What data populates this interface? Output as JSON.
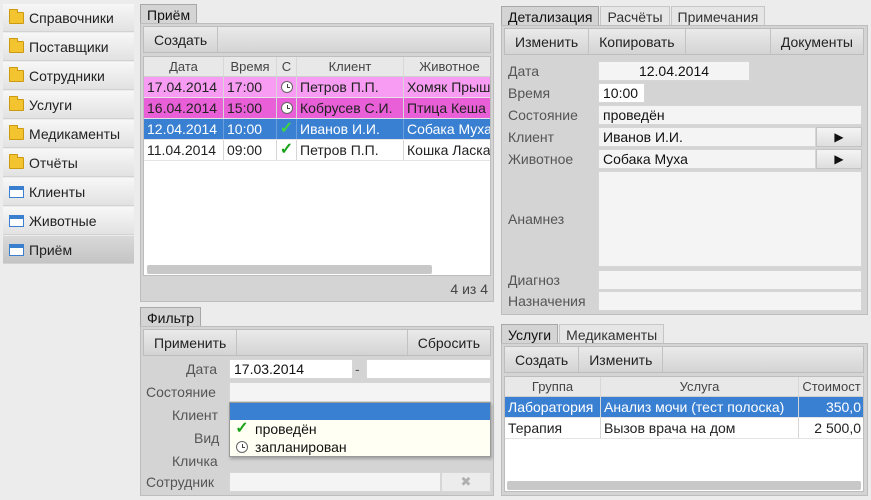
{
  "sidebar": {
    "items": [
      {
        "label": "Справочники",
        "icon": "folder-icon"
      },
      {
        "label": "Поставщики",
        "icon": "folder-icon"
      },
      {
        "label": "Сотрудники",
        "icon": "folder-icon"
      },
      {
        "label": "Услуги",
        "icon": "folder-icon"
      },
      {
        "label": "Медикаменты",
        "icon": "folder-icon"
      },
      {
        "label": "Отчёты",
        "icon": "folder-icon"
      },
      {
        "label": "Клиенты",
        "icon": "window-icon"
      },
      {
        "label": "Животные",
        "icon": "window-icon"
      },
      {
        "label": "Приём",
        "icon": "window-icon",
        "active": true
      }
    ]
  },
  "reception": {
    "tab": "Приём",
    "create_label": "Создать",
    "columns": [
      "Дата",
      "Время",
      "С",
      "Клиент",
      "Животное"
    ],
    "rows": [
      {
        "date": "17.04.2014",
        "time": "17:00",
        "status_icon": "clock-icon",
        "client": "Петров П.П.",
        "animal": "Хомяк Прыш",
        "bg": "#f79cf2"
      },
      {
        "date": "16.04.2014",
        "time": "15:00",
        "status_icon": "clock-icon",
        "client": "Кобрусев С.И.",
        "animal": "Птица Кеша",
        "bg": "#e85fd8"
      },
      {
        "date": "12.04.2014",
        "time": "10:00",
        "status_icon": "check-icon",
        "client": "Иванов И.И.",
        "animal": "Собака Муха",
        "bg": "#3a80d2",
        "selected": true
      },
      {
        "date": "11.04.2014",
        "time": "09:00",
        "status_icon": "check-icon",
        "client": "Петров П.П.",
        "animal": "Кошка Ласка",
        "bg": "#ffffff"
      }
    ],
    "count": "4 из 4"
  },
  "filter": {
    "tab": "Фильтр",
    "apply_label": "Применить",
    "reset_label": "Сбросить",
    "date_label": "Дата",
    "date_from": "17.03.2014",
    "date_sep": "-",
    "date_to": "",
    "state_label": "Состояние",
    "client_label": "Клиент",
    "type_label": "Вид",
    "nickname_label": "Кличка",
    "staff_label": "Сотрудник",
    "clear_glyph": "✖",
    "state_options": [
      {
        "label": "проведён",
        "icon": "check-icon"
      },
      {
        "label": "запланирован",
        "icon": "clock-icon"
      }
    ]
  },
  "details": {
    "tabs": [
      "Детализация",
      "Расчёты",
      "Примечания"
    ],
    "buttons": {
      "edit": "Изменить",
      "copy": "Копировать",
      "docs": "Документы"
    },
    "fields": {
      "date_label": "Дата",
      "date": "12.04.2014",
      "time_label": "Время",
      "time": "10:00",
      "state_label": "Состояние",
      "state": "проведён",
      "client_label": "Клиент",
      "client": "Иванов И.И.",
      "animal_label": "Животное",
      "animal": "Собака Муха",
      "anamnesis_label": "Анамнез",
      "anamnesis": "",
      "diagnosis_label": "Диагноз",
      "diagnosis": "",
      "prescription_label": "Назначения",
      "prescription": ""
    },
    "arrow_glyph": "▶"
  },
  "services": {
    "tabs": [
      "Услуги",
      "Медикаменты"
    ],
    "create_label": "Создать",
    "edit_label": "Изменить",
    "columns": [
      "Группа",
      "Услуга",
      "Стоимост"
    ],
    "rows": [
      {
        "group": "Лаборатория",
        "service": "Анализ мочи (тест полоска)",
        "cost": "350,0",
        "selected": true
      },
      {
        "group": "Терапия",
        "service": "Вызов врача на дом",
        "cost": "2 500,0"
      }
    ]
  },
  "colors": {
    "selection": "#3a80d2",
    "planned_row": "#f79cf2",
    "planned_row_2": "#e85fd8",
    "check": "#1aa31a"
  }
}
